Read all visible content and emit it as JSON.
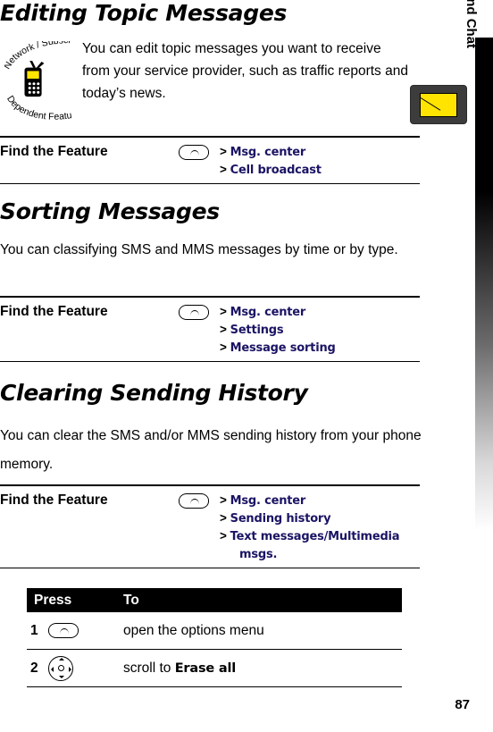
{
  "page": {
    "number": "87",
    "side_tab": "Messages and Chat"
  },
  "sections": [
    {
      "heading": "Editing Topic Messages",
      "intro": "You can edit topic messages you want to receive from your service provider, such as traffic reports and today’s news.",
      "icon_caption": "Network / Subscription Dependent Feature"
    },
    {
      "heading": "Sorting Messages",
      "intro": "You can classifying SMS and MMS messages by time or by type."
    },
    {
      "heading": "Clearing Sending History",
      "intro": "You can clear the SMS and/or MMS sending history from your phone memory."
    }
  ],
  "find_the_feature": {
    "label": "Find the Feature",
    "blocks": [
      {
        "steps": [
          {
            "prefix": ">",
            "value": "Msg. center"
          },
          {
            "prefix": ">",
            "value": "Cell broadcast"
          }
        ]
      },
      {
        "steps": [
          {
            "prefix": ">",
            "value": "Msg. center"
          },
          {
            "prefix": ">",
            "value": "Settings"
          },
          {
            "prefix": ">",
            "value": "Message sorting"
          }
        ]
      },
      {
        "steps": [
          {
            "prefix": ">",
            "value": "Msg. center"
          },
          {
            "prefix": ">",
            "value": "Sending history"
          },
          {
            "prefix": ">",
            "value": "Text messages/Multimedia"
          },
          {
            "prefix": "",
            "value": "msgs."
          }
        ]
      }
    ]
  },
  "press_table": {
    "headers": {
      "press": "Press",
      "to": "To"
    },
    "rows": [
      {
        "num": "1",
        "key": "menu-key",
        "desc_plain": "open the options menu",
        "desc_bold": ""
      },
      {
        "num": "2",
        "key": "nav-key",
        "desc_plain": "scroll to ",
        "desc_bold": "Erase all"
      }
    ]
  }
}
